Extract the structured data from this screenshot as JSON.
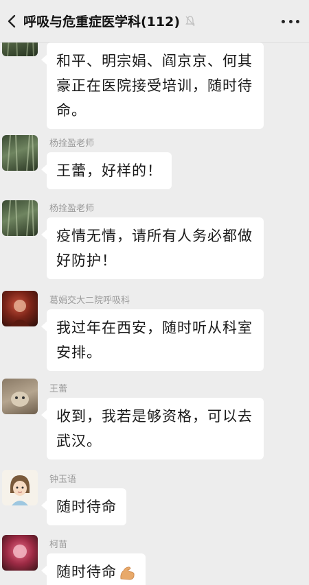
{
  "header": {
    "title": "呼吸与危重症医学科(112)",
    "back_icon": "chevron-left-icon",
    "mute_icon": "mute-bell-icon",
    "more_icon": "more-dots-icon"
  },
  "messages": [
    {
      "sender": "",
      "text": "和平、明宗娟、阎京京、何其豪正在医院接受培训，随时待命。",
      "avatar": "forest-avatar"
    },
    {
      "sender": "杨拴盈老师",
      "text": "王蕾，好样的！",
      "avatar": "forest-avatar"
    },
    {
      "sender": "杨拴盈老师",
      "text": "疫情无情，请所有人务必都做好防护！",
      "avatar": "forest-avatar"
    },
    {
      "sender": "葛娟交大二院呼吸科",
      "text": "我过年在西安，随时听从科室安排。",
      "avatar": "red-avatar"
    },
    {
      "sender": "王蕾",
      "text": "收到，我若是够资格，可以去武汉。",
      "avatar": "animal-avatar"
    },
    {
      "sender": "钟玉语",
      "text": "随时待命",
      "avatar": "cartoon-girl-avatar"
    },
    {
      "sender": "柯苗",
      "text": "随时待命",
      "avatar": "pink-avatar",
      "emoji": "flexed-biceps-icon"
    }
  ]
}
